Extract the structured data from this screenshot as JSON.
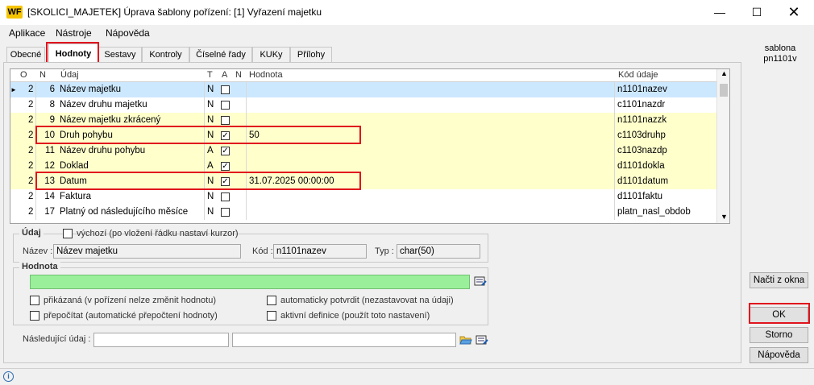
{
  "window": {
    "title": "[SKOLICI_MAJETEK] Úprava šablony pořízení: [1] Vyřazení majetku",
    "logo": "WF"
  },
  "menu": [
    "Aplikace",
    "Nástroje",
    "Nápověda"
  ],
  "tabs": [
    "Obecné",
    "Hodnoty",
    "Sestavy",
    "Kontroly",
    "Číselné řady",
    "KUKy",
    "Přílohy"
  ],
  "active_tab": "Hodnoty",
  "side": {
    "line1": "sablona",
    "line2": "pn1101v"
  },
  "grid": {
    "headers": {
      "o": "O",
      "n": "N",
      "udaj": "Údaj",
      "t": "T",
      "a": "A",
      "nn": "N",
      "hodnota": "Hodnota",
      "kod": "Kód údaje"
    },
    "rows": [
      {
        "o": "2",
        "n": "6",
        "name": "Název majetku",
        "t": "N",
        "a": false,
        "value": "",
        "code": "n1101nazev",
        "style": "selected"
      },
      {
        "o": "2",
        "n": "8",
        "name": "Název druhu majetku",
        "t": "N",
        "a": false,
        "value": "",
        "code": "c1101nazdr",
        "style": "white"
      },
      {
        "o": "2",
        "n": "9",
        "name": "Název majetku zkrácený",
        "t": "N",
        "a": false,
        "value": "",
        "code": "n1101nazzk",
        "style": "yellow"
      },
      {
        "o": "2",
        "n": "10",
        "name": "Druh pohybu",
        "t": "N",
        "a": true,
        "value": "50",
        "code": "c1103druhp",
        "style": "yellow"
      },
      {
        "o": "2",
        "n": "11",
        "name": "Název druhu pohybu",
        "t": "A",
        "a": true,
        "value": "",
        "code": "c1103nazdp",
        "style": "yellow"
      },
      {
        "o": "2",
        "n": "12",
        "name": "Doklad",
        "t": "A",
        "a": true,
        "value": "",
        "code": "d1101dokla",
        "style": "yellow"
      },
      {
        "o": "2",
        "n": "13",
        "name": "Datum",
        "t": "N",
        "a": true,
        "value": "31.07.2025 00:00:00",
        "code": "d1101datum",
        "style": "yellow"
      },
      {
        "o": "2",
        "n": "14",
        "name": "Faktura",
        "t": "N",
        "a": false,
        "value": "",
        "code": "d1101faktu",
        "style": "white"
      },
      {
        "o": "2",
        "n": "17",
        "name": "Platný od následujícího měsíce",
        "t": "N",
        "a": false,
        "value": "",
        "code": "platn_nasl_obdob",
        "style": "white"
      }
    ]
  },
  "udaj": {
    "group_label": "Údaj",
    "default_label": "výchozí (po vložení řádku nastaví kurzor)",
    "name_label": "Název :",
    "name_value": "Název majetku",
    "code_label": "Kód :",
    "code_value": "n1101nazev",
    "type_label": "Typ :",
    "type_value": "char(50)"
  },
  "hodnota": {
    "group_label": "Hodnota",
    "value": "",
    "opt_mandatory": "přikázaná (v pořízení nelze změnit hodnotu)",
    "opt_recalc": "přepočítat (automatické přepočtení hodnoty)",
    "opt_autoconfirm": "automaticky potvrdit (nezastavovat na údaji)",
    "opt_active": "aktivní definice (použít toto nastavení)"
  },
  "next": {
    "label": "Následující údaj :",
    "value1": "",
    "value2": ""
  },
  "buttons": {
    "load": "Načti z okna",
    "ok": "OK",
    "cancel": "Storno",
    "help": "Nápověda"
  },
  "colors": {
    "selected": "#cce8ff",
    "yellow": "#ffffcc",
    "white": "#ffffff",
    "value_bg": "#9af09a",
    "highlight": "#e0141e"
  }
}
